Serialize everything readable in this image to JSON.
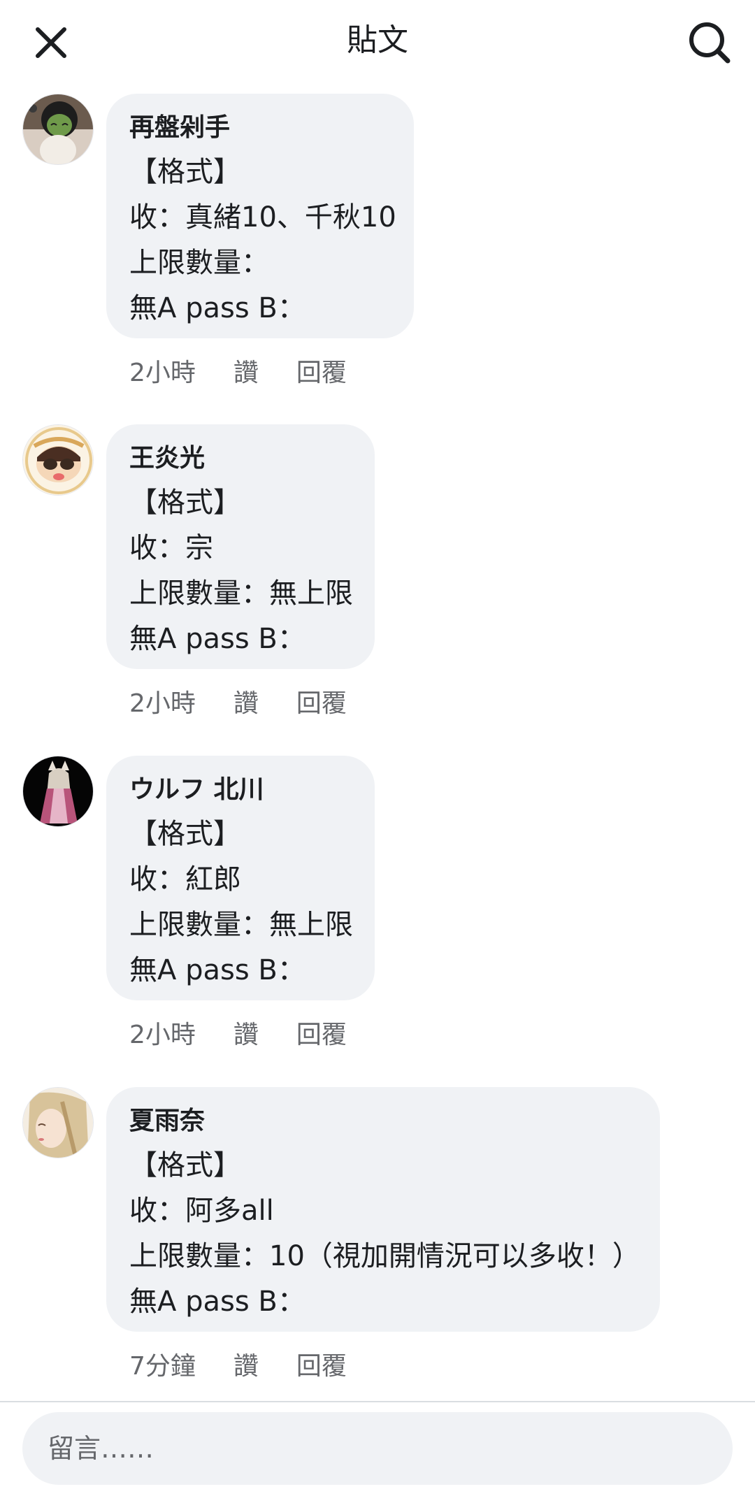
{
  "header": {
    "title": "貼文"
  },
  "comments": [
    {
      "author": "再盤剁手",
      "lines": [
        "【格式】",
        "收：真緒10、千秋10",
        "上限數量：",
        "無A pass B："
      ],
      "time": "2小時",
      "like_label": "讚",
      "reply_label": "回覆"
    },
    {
      "author": "王炎光",
      "lines": [
        "【格式】",
        "收：宗",
        "上限數量：無上限",
        "無A pass B："
      ],
      "time": "2小時",
      "like_label": "讚",
      "reply_label": "回覆"
    },
    {
      "author": "ウルフ 北川",
      "lines": [
        "【格式】",
        "收：紅郎",
        "上限數量：無上限",
        "無A pass B："
      ],
      "time": "2小時",
      "like_label": "讚",
      "reply_label": "回覆"
    },
    {
      "author": "夏雨奈",
      "lines": [
        "【格式】",
        "收：阿多all",
        "上限數量：10（視加開情況可以多收！）",
        "無A pass B："
      ],
      "time": "7分鐘",
      "like_label": "讚",
      "reply_label": "回覆"
    }
  ],
  "composer": {
    "placeholder": "留言……"
  },
  "colors": {
    "bubble": "#f0f2f5",
    "secondary_text": "#65676b",
    "divider": "#dadde1"
  },
  "icons": {
    "close": "close-icon",
    "search": "search-icon"
  }
}
